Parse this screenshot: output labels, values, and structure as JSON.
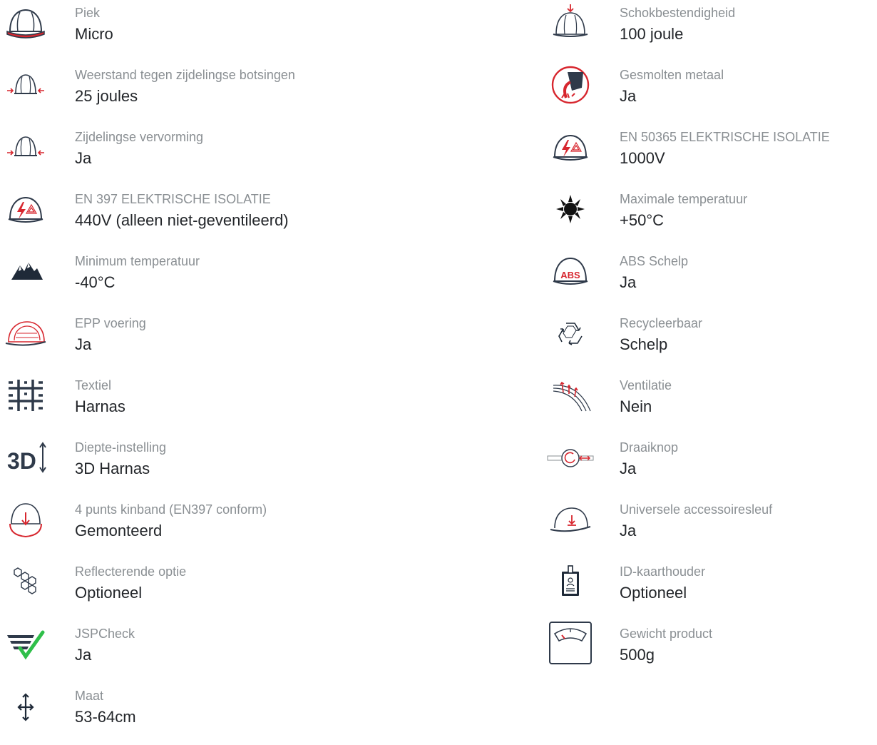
{
  "colors": {
    "accent": "#d7262e",
    "dark": "#2f3a4a",
    "label": "#8a8f93",
    "value": "#23262a",
    "check": "#2fbf4a"
  },
  "left": [
    {
      "icon": "helmet-peak-icon",
      "label": "Piek",
      "value": "Micro"
    },
    {
      "icon": "side-impact-icon",
      "label": "Weerstand tegen zijdelingse botsingen",
      "value": "25 joules"
    },
    {
      "icon": "lateral-deformation-icon",
      "label": "Zijdelingse vervorming",
      "value": "Ja"
    },
    {
      "icon": "electrical-insulation-icon",
      "label": "EN 397 ELEKTRISCHE ISOLATIE",
      "value": "440V (alleen niet-geventileerd)"
    },
    {
      "icon": "mountains-cold-icon",
      "label": "Minimum temperatuur",
      "value": "-40°C"
    },
    {
      "icon": "epp-liner-icon",
      "label": "EPP voering",
      "value": "Ja"
    },
    {
      "icon": "textile-grid-icon",
      "label": "Textiel",
      "value": "Harnas"
    },
    {
      "icon": "depth-3d-icon",
      "label": "Diepte-instelling",
      "value": "3D Harnas"
    },
    {
      "icon": "chinstrap-icon",
      "label": "4 punts kinband (EN397 conform)",
      "value": "Gemonteerd"
    },
    {
      "icon": "reflective-hex-icon",
      "label": "Reflecterende optie",
      "value": "Optioneel"
    },
    {
      "icon": "jspcheck-icon",
      "label": "JSPCheck",
      "value": "Ja"
    },
    {
      "icon": "size-arrows-icon",
      "label": "Maat",
      "value": "53-64cm"
    }
  ],
  "right": [
    {
      "icon": "shock-resistance-icon",
      "label": "Schokbestendigheid",
      "value": "100 joule"
    },
    {
      "icon": "molten-metal-icon",
      "label": "Gesmolten metaal",
      "value": "Ja"
    },
    {
      "icon": "electrical-insulation-icon",
      "label": "EN 50365 ELEKTRISCHE ISOLATIE",
      "value": "1000V"
    },
    {
      "icon": "sun-heat-icon",
      "label": "Maximale temperatuur",
      "value": "+50°C"
    },
    {
      "icon": "abs-shell-icon",
      "label": "ABS Schelp",
      "value": "Ja",
      "badge": "ABS"
    },
    {
      "icon": "recycle-icon",
      "label": "Recycleerbaar",
      "value": "Schelp"
    },
    {
      "icon": "ventilation-icon",
      "label": "Ventilatie",
      "value": "Nein"
    },
    {
      "icon": "dial-knob-icon",
      "label": "Draaiknop",
      "value": "Ja"
    },
    {
      "icon": "accessory-slot-icon",
      "label": "Universele accessoiresleuf",
      "value": "Ja"
    },
    {
      "icon": "id-card-holder-icon",
      "label": "ID-kaarthouder",
      "value": "Optioneel"
    },
    {
      "icon": "weight-scale-icon",
      "label": "Gewicht product",
      "value": "500g"
    }
  ]
}
